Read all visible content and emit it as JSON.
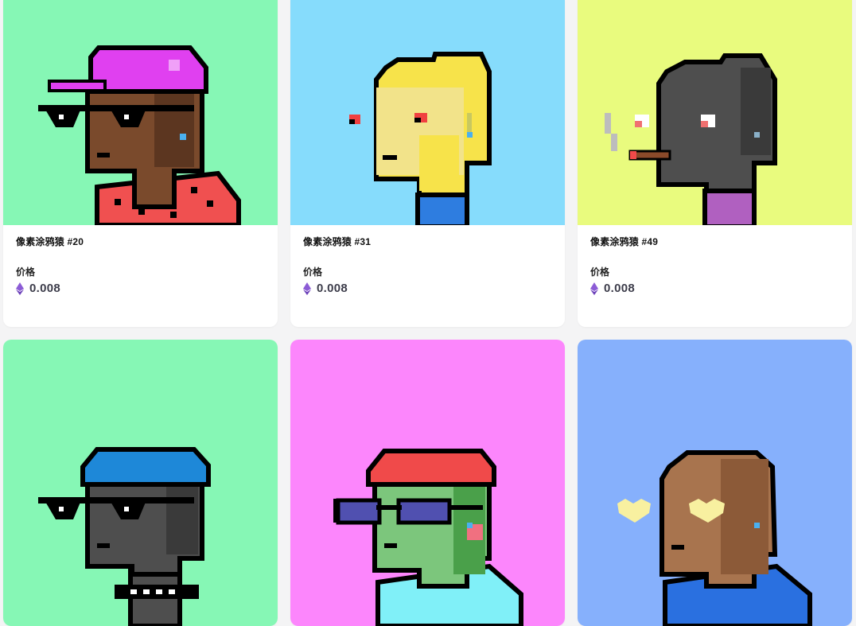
{
  "nft_grid": {
    "price_label": "价格",
    "currency_icon": "ethereum-icon",
    "items": [
      {
        "name": "像素涂鸦猿 #20",
        "price": "0.008",
        "bg": "#86f7b5",
        "skin": "#7a4a2c",
        "hat": "#e040f0"
      },
      {
        "name": "像素涂鸦猿 #31",
        "price": "0.008",
        "bg": "#86dcfc",
        "skin": "#f7e34a",
        "hat": ""
      },
      {
        "name": "像素涂鸦猿 #49",
        "price": "0.008",
        "bg": "#e9fb7e",
        "skin": "#4e4e4e",
        "hat": ""
      },
      {
        "name": "",
        "price": "",
        "bg": "#86f7b5",
        "skin": "#4e4e4e",
        "hat": "#1e88d8"
      },
      {
        "name": "",
        "price": "",
        "bg": "#fc86fc",
        "skin": "#7cc67c",
        "hat": "#f04a4a"
      },
      {
        "name": "",
        "price": "",
        "bg": "#86b0fc",
        "skin": "#a8744e",
        "hat": ""
      }
    ]
  }
}
